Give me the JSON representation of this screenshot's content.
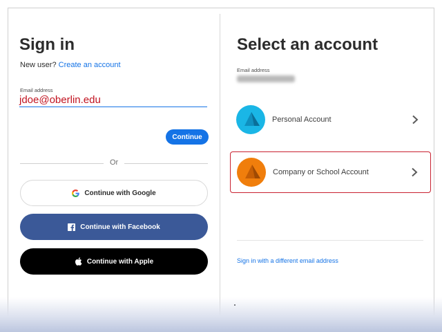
{
  "left": {
    "title": "Sign in",
    "new_user_prefix": "New user?",
    "create_account_link": "Create an account",
    "email_label": "Email address",
    "email_value": "jdoe@oberlin.edu",
    "continue_button": "Continue",
    "or_text": "Or",
    "google_button": "Continue with Google",
    "facebook_button": "Continue with Facebook",
    "apple_button": "Continue with Apple"
  },
  "right": {
    "title": "Select an account",
    "email_label": "Email address",
    "accounts": [
      {
        "label": "Personal Account",
        "avatar_color": "#1ab6e6",
        "icon": "personal-account-icon"
      },
      {
        "label": "Company or School Account",
        "avatar_color": "#f07e0c",
        "icon": "company-account-icon",
        "highlighted": true
      }
    ],
    "different_email_link": "Sign in with a different email address"
  },
  "colors": {
    "accent_blue": "#1473e6",
    "facebook_blue": "#3b5998",
    "highlight_red": "#c8202f",
    "email_text_red": "#c1121f"
  }
}
